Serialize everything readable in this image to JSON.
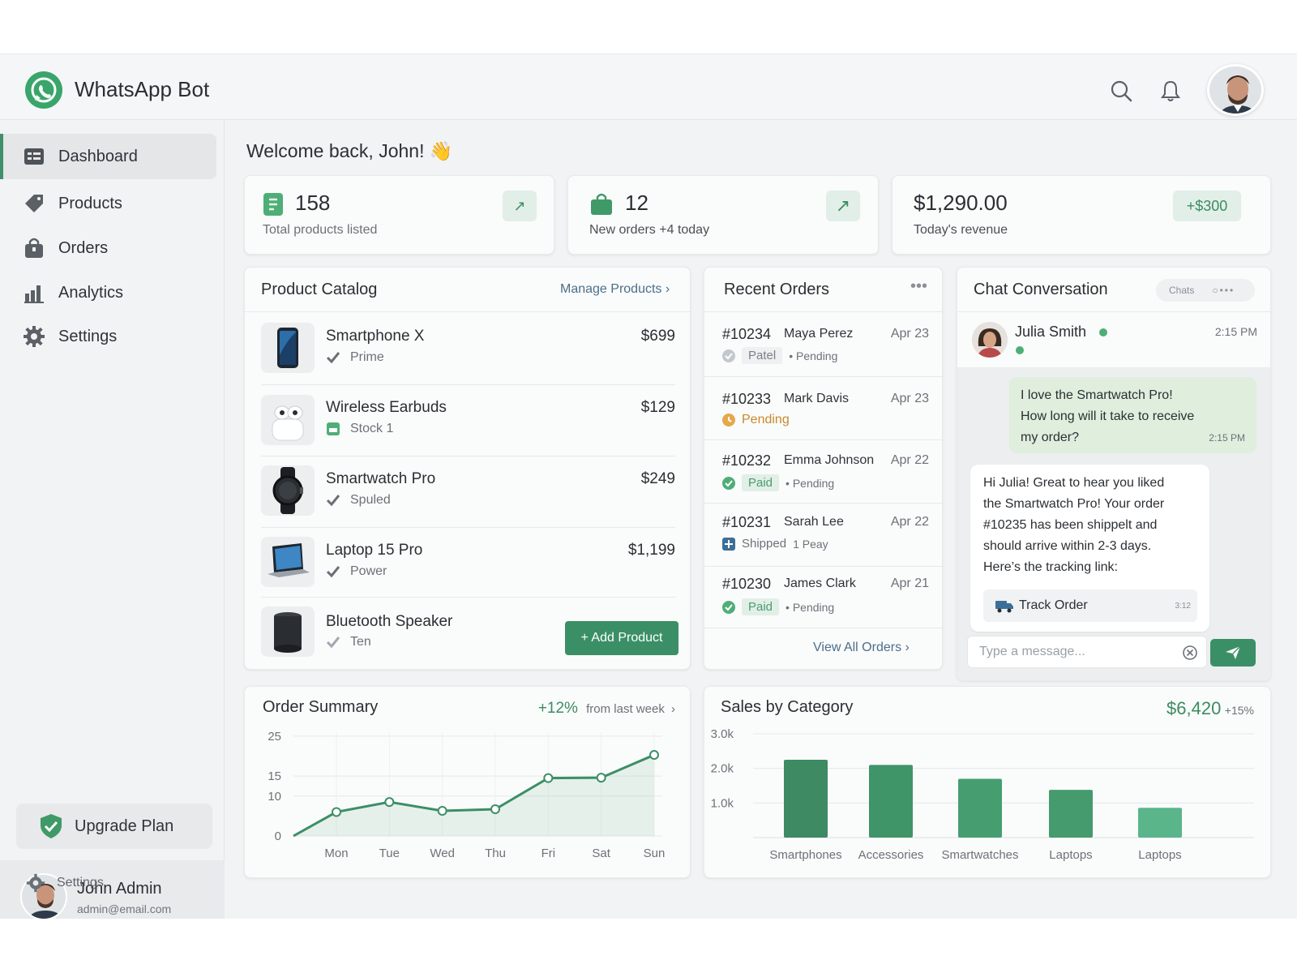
{
  "app": {
    "title": "WhatsApp Bot"
  },
  "nav": [
    {
      "label": "Dashboard",
      "icon": "dashboard-icon",
      "active": true
    },
    {
      "label": "Products",
      "icon": "tag-icon"
    },
    {
      "label": "Orders",
      "icon": "bag-icon"
    },
    {
      "label": "Analytics",
      "icon": "bar-chart-icon"
    },
    {
      "label": "Settings",
      "icon": "gear-icon"
    }
  ],
  "sidebar": {
    "upgrade_label": "Upgrade Plan",
    "user_name": "John Admin",
    "user_email": "admin@email.com",
    "settings_label": "Settings"
  },
  "welcome": {
    "text": "Welcome back, John! 👋"
  },
  "stats": {
    "products": {
      "value": "158",
      "label": "Total products listed"
    },
    "orders": {
      "value": "12",
      "label": "New orders +4  today"
    },
    "revenue": {
      "value": "$1,290.00",
      "label": "Today's revenue",
      "badge": "+$300"
    }
  },
  "catalog": {
    "title": "Product Catalog",
    "manage_link": "Manage Products",
    "add_button": "+ Add Product",
    "items": [
      {
        "name": "Smartphone X",
        "tag": "Prime",
        "price": "$699"
      },
      {
        "name": "Wireless Earbuds",
        "tag": "Stock 1",
        "price": "$129"
      },
      {
        "name": "Smartwatch Pro",
        "tag": "Spuled",
        "price": "$249"
      },
      {
        "name": "Laptop 15 Pro",
        "tag": "Power",
        "price": "$1,199"
      },
      {
        "name": "Bluetooth Speaker",
        "tag": "Ten",
        "price": ""
      }
    ]
  },
  "orders": {
    "title": "Recent Orders",
    "view_all": "View All Orders",
    "items": [
      {
        "id": "#10234",
        "name": "Maya Perez",
        "date": "Apr 23",
        "status": "Patel",
        "sub": "• Pending"
      },
      {
        "id": "#10233",
        "name": "Mark Davis",
        "date": "Apr 23",
        "status": "Pending",
        "sub": ""
      },
      {
        "id": "#10232",
        "name": "Emma Johnson",
        "date": "Apr 22",
        "status": "Paid",
        "sub": "• Pending"
      },
      {
        "id": "#10231",
        "name": "Sarah Lee",
        "date": "Apr 22",
        "status": "Shipped",
        "sub": "1 Peay"
      },
      {
        "id": "#10230",
        "name": "James Clark",
        "date": "Apr 21",
        "status": "Paid",
        "sub": "• Pending"
      }
    ]
  },
  "chat": {
    "title": "Chat Conversation",
    "chats_label": "Chats",
    "contact_name": "Julia Smith",
    "contact_time": "2:15 PM",
    "incoming": [
      "I love the Smartwatch Pro!",
      "How long will it take to receive",
      "my order?"
    ],
    "incoming_time": "2:15 PM",
    "outgoing": [
      "Hi Julia! Great to hear you liked",
      "the Smartwatch Pro! Your order",
      "#10235 has been shippelt and",
      "should arrive within 2-3 days.",
      "Here’s the tracking link:"
    ],
    "track_label": "Track Order",
    "track_time": "3:12",
    "input_placeholder": "Type a message..."
  },
  "order_summary": {
    "title": "Order Summary",
    "change": "+12%",
    "change_label": "from last week"
  },
  "sales": {
    "title": "Sales by Category",
    "total": "$6,420",
    "change": "+15%"
  },
  "colors": {
    "accent": "#3b8f66",
    "accent_light": "#e2efe8"
  },
  "chart_data": [
    {
      "type": "line",
      "title": "Order Summary",
      "categories": [
        "Mon",
        "Tue",
        "Wed",
        "Thu",
        "Fri",
        "Sat",
        "Sun"
      ],
      "y_ticks": [
        "0",
        "10",
        "15",
        "25"
      ],
      "series": [
        {
          "values": [
            6,
            8.5,
            6.3,
            6.7,
            14.5,
            14.6,
            20.3
          ]
        }
      ],
      "ylim": [
        0,
        26
      ],
      "grid": true
    },
    {
      "type": "bar",
      "title": "Sales by Category",
      "categories": [
        "Smartphones",
        "Accessories",
        "Smartwatches",
        "Laptops",
        "Laptops"
      ],
      "y_ticks": [
        "1.0k",
        "2.0k",
        "3.0k"
      ],
      "values": [
        2250,
        2100,
        1700,
        1380,
        860
      ],
      "ylim": [
        0,
        3000
      ],
      "grid": true
    }
  ]
}
